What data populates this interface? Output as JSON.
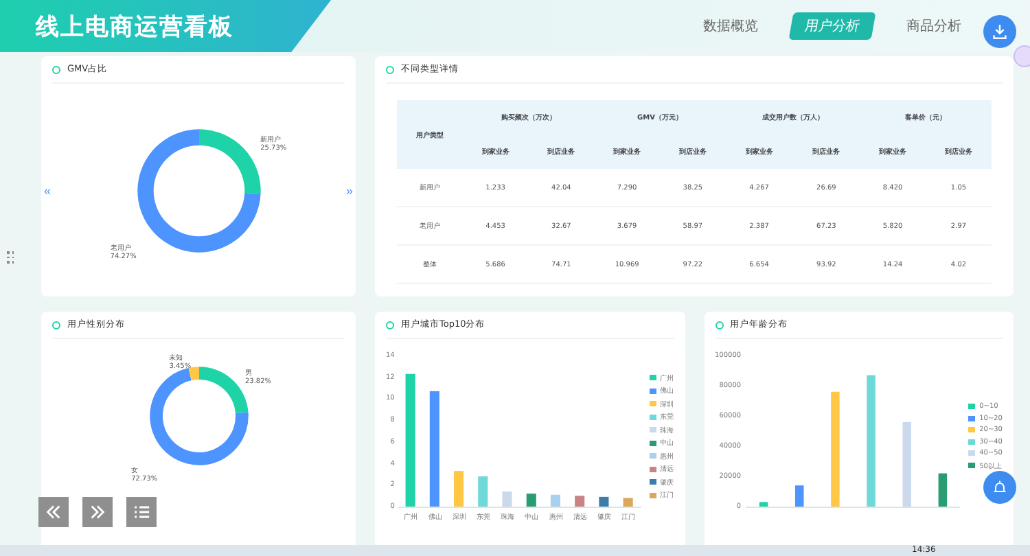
{
  "header": {
    "title": "线上电商运营看板"
  },
  "tabs": [
    {
      "label": "数据概览",
      "selected": false
    },
    {
      "label": "用户分析",
      "selected": true
    },
    {
      "label": "商品分析",
      "selected": false
    }
  ],
  "gmv_card": {
    "title": "GMV占比",
    "chart_data": {
      "type": "donut",
      "categories": [
        "新用户",
        "老用户"
      ],
      "values": [
        25.73,
        74.27
      ],
      "colors": [
        "#1fd3a8",
        "#4e94ff"
      ],
      "value_labels": [
        "25.73%",
        "74.27%"
      ]
    },
    "prev": "«",
    "next": "»"
  },
  "detail_card": {
    "title": "不同类型详情",
    "table": {
      "row_header": "用户类型",
      "groups": [
        "购买频次（万次）",
        "GMV（万元）",
        "成交用户数（万人）",
        "客单价（元）"
      ],
      "subcolumns": [
        "到家业务",
        "到店业务",
        "到家业务",
        "到店业务",
        "到家业务",
        "到店业务",
        "到家业务",
        "到店业务"
      ],
      "rows": [
        {
          "type": "新用户",
          "cells": [
            "1.233",
            "42.04",
            "7.290",
            "38.25",
            "4.267",
            "26.69",
            "8.420",
            "1.05"
          ]
        },
        {
          "type": "老用户",
          "cells": [
            "4.453",
            "32.67",
            "3.679",
            "58.97",
            "2.387",
            "67.23",
            "5.820",
            "2.97"
          ]
        },
        {
          "type": "整体",
          "cells": [
            "5.686",
            "74.71",
            "10.969",
            "97.22",
            "6.654",
            "93.92",
            "14.24",
            "4.02"
          ]
        }
      ]
    }
  },
  "gender_card": {
    "title": "用户性别分布",
    "chart_data": {
      "type": "donut",
      "categories": [
        "男",
        "女",
        "未知"
      ],
      "values": [
        23.82,
        72.73,
        3.45
      ],
      "colors": [
        "#1fd3a8",
        "#4e94ff",
        "#ffc744"
      ],
      "value_labels": [
        "23.82%",
        "72.73%",
        "3.45%"
      ]
    }
  },
  "city_card": {
    "title": "用户城市Top10分布",
    "chart_data": {
      "type": "bar",
      "categories": [
        "广州",
        "佛山",
        "深圳",
        "东莞",
        "珠海",
        "中山",
        "惠州",
        "清远",
        "肇庆",
        "江门"
      ],
      "series": [
        {
          "name": "广州",
          "color": "#1fd3a8",
          "values": [
            12.3,
            null,
            null,
            null,
            null,
            null,
            null,
            null,
            null,
            null
          ]
        },
        {
          "name": "佛山",
          "color": "#4e94ff",
          "values": [
            null,
            10.7,
            null,
            null,
            null,
            null,
            null,
            null,
            null,
            null
          ]
        },
        {
          "name": "深圳",
          "color": "#ffc744",
          "values": [
            null,
            null,
            3.3,
            null,
            null,
            null,
            null,
            null,
            null,
            null
          ]
        },
        {
          "name": "东莞",
          "color": "#6fd8d8",
          "values": [
            null,
            null,
            null,
            2.8,
            null,
            null,
            null,
            null,
            null,
            null
          ]
        },
        {
          "name": "珠海",
          "color": "#cbd9ec",
          "values": [
            null,
            null,
            null,
            null,
            1.4,
            null,
            null,
            null,
            null,
            null
          ]
        },
        {
          "name": "中山",
          "color": "#2a9c72",
          "values": [
            null,
            null,
            null,
            null,
            null,
            1.2,
            null,
            null,
            null,
            null
          ]
        },
        {
          "name": "惠州",
          "color": "#a8d0ef",
          "values": [
            null,
            null,
            null,
            null,
            null,
            null,
            1.1,
            null,
            null,
            null
          ]
        },
        {
          "name": "清远",
          "color": "#c98383",
          "values": [
            null,
            null,
            null,
            null,
            null,
            null,
            null,
            1.0,
            null,
            null
          ]
        },
        {
          "name": "肇庆",
          "color": "#3b7fa8",
          "values": [
            null,
            null,
            null,
            null,
            null,
            null,
            null,
            null,
            0.9,
            null
          ]
        },
        {
          "name": "江门",
          "color": "#d9a85a",
          "values": [
            null,
            null,
            null,
            null,
            null,
            null,
            null,
            null,
            null,
            0.8
          ]
        }
      ],
      "ylim": [
        0,
        14
      ],
      "yticks": [
        0,
        2,
        4,
        6,
        8,
        10,
        12,
        14
      ],
      "legend": "right"
    }
  },
  "age_card": {
    "title": "用户年龄分布",
    "chart_data": {
      "type": "bar",
      "series": [
        {
          "name": "0~10",
          "color": "#1fd3a8",
          "values": [
            3000
          ]
        },
        {
          "name": "10~20",
          "color": "#4e94ff",
          "values": [
            14000
          ]
        },
        {
          "name": "20~30",
          "color": "#ffc744",
          "values": [
            76000
          ]
        },
        {
          "name": "30~40",
          "color": "#6fd8d8",
          "values": [
            87000
          ]
        },
        {
          "name": "40~50",
          "color": "#cbd9ec",
          "values": [
            56000
          ]
        },
        {
          "name": "50以上",
          "color": "#2a9c72",
          "values": [
            22000
          ]
        }
      ],
      "ylim": [
        0,
        100000
      ],
      "yticks": [
        0,
        20000,
        40000,
        60000,
        80000,
        100000
      ],
      "legend": "right"
    }
  },
  "taskbar": {
    "clock": "14:36"
  }
}
